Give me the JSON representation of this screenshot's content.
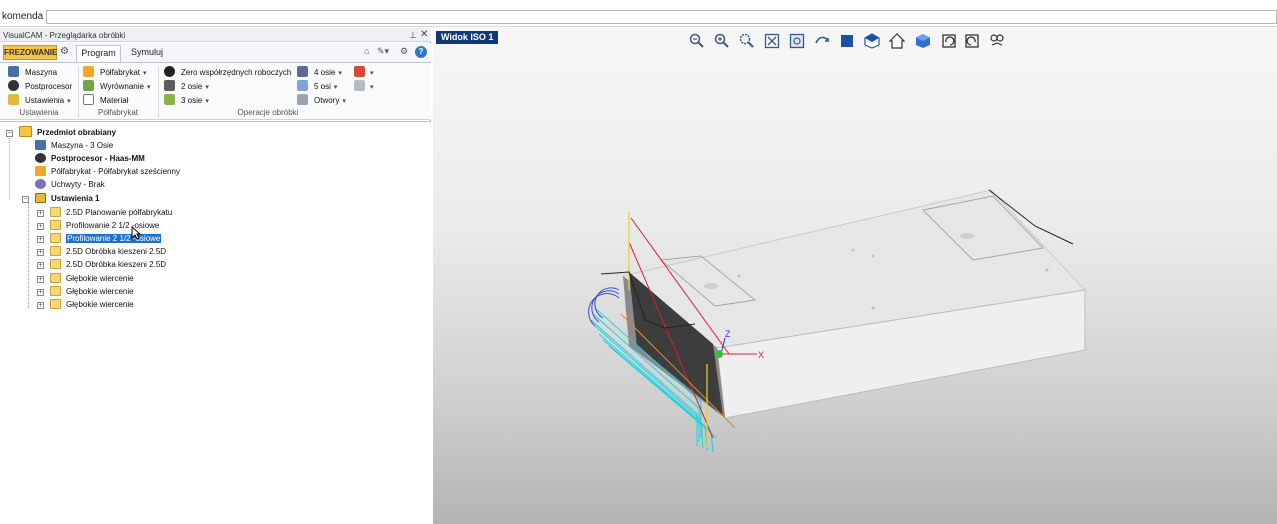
{
  "command": {
    "label": "komenda",
    "value": ""
  },
  "panel": {
    "title": "VisualCAM - Przeglądarka obróbki",
    "tab_mode": "FREZOWANIE",
    "tabs": [
      "Program",
      "Symuluj"
    ]
  },
  "ribbon": {
    "ustawienia": {
      "items": [
        "Maszyna",
        "Postprocesor",
        "Ustawienia"
      ],
      "group": "Ustawienia"
    },
    "polfabrykat": {
      "items": [
        "Półfabrykat",
        "Wyrównanie",
        "Materiał"
      ],
      "group": "Półfabrykat"
    },
    "operacje": {
      "items": [
        "Zero współrzędnych roboczych",
        "2 osie",
        "3 osie",
        "4 osie",
        "5 osi",
        "Otwory"
      ],
      "group": "Operacje obróbki"
    }
  },
  "tree": {
    "root": "Przedmiot obrabiany",
    "items": [
      "Maszyna - 3 Osie",
      "Postprocesor - Haas-MM",
      "Półfabrykat - Półfabrykat sześcienny",
      "Uchwyty - Brak",
      "Ustawienia 1"
    ],
    "operations": [
      "2.5D Planowanie półfabrykatu",
      "Profilowanie 2 1/2 -osiowe",
      "Profilowanie 2 1/2 -osiowe",
      "2.5D Obróbka kieszeni 2.5D",
      "2.5D Obróbka kieszeni 2.5D",
      "Głębokie wiercenie",
      "Głębokie wiercenie",
      "Głębokie wiercenie"
    ]
  },
  "viewport": {
    "title": "Widok ISO 1",
    "axes": {
      "x": "X",
      "z": "Z"
    },
    "toolbar_icons": [
      "zoom-out-icon",
      "zoom-in-icon",
      "zoom-window-icon",
      "zoom-extents-icon",
      "zoom-selected-icon",
      "pan-icon",
      "view-front-icon",
      "view-iso-icon",
      "view-home-icon",
      "view-cube-icon",
      "undo-view-icon",
      "redo-view-icon",
      "display-options-icon"
    ]
  },
  "colors": {
    "accent_tab": "#f6c445",
    "selection": "#1f6fd1",
    "viewport_title": "#0f3a78",
    "toolpath_cyan": "#1ad3e0",
    "toolpath_red": "#d8232a"
  }
}
